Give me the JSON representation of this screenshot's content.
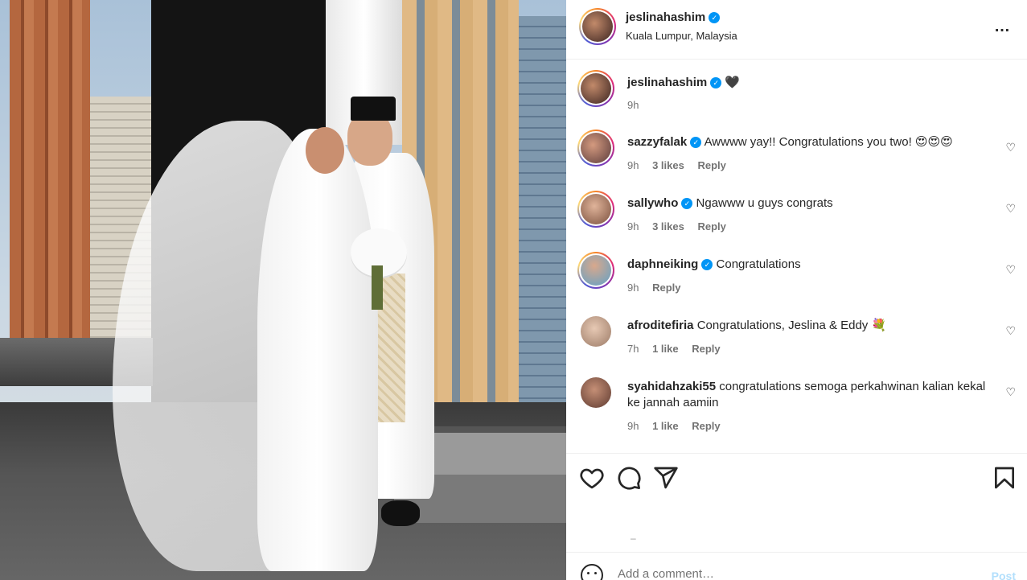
{
  "post": {
    "username": "jeslinahashim",
    "location": "Kuala Lumpur, Malaysia",
    "more_icon": "…",
    "caption_text": "🖤",
    "caption_time": "9h",
    "photo_alt": "Wedding couple in white standing by a window"
  },
  "comments": [
    {
      "user": "sazzyfalak",
      "verified": true,
      "text": "Awwww yay!! Congratulations you two! 😍😍😍",
      "time": "9h",
      "likes": "3 likes",
      "reply": "Reply",
      "avatar_color": "#5a3b3b",
      "ring": true
    },
    {
      "user": "sallywho",
      "verified": true,
      "text": "Ngawww u guys congrats",
      "time": "9h",
      "likes": "3 likes",
      "reply": "Reply",
      "avatar_color": "#b5856a",
      "ring": true
    },
    {
      "user": "daphneiking",
      "verified": true,
      "text": "Congratulations",
      "time": "9h",
      "likes": "",
      "reply": "Reply",
      "avatar_color": "#5fa1c8",
      "ring": true
    },
    {
      "user": "afroditefiria",
      "verified": false,
      "text": "Congratulations, Jeslina & Eddy 💐",
      "time": "7h",
      "likes": "1 like",
      "reply": "Reply",
      "avatar_color": "#c9a894",
      "ring": false
    },
    {
      "user": "syahidahzaki55",
      "verified": false,
      "text": "congratulations semoga perkahwinan kalian kekal ke jannah aamiin",
      "time": "9h",
      "likes": "1 like",
      "reply": "Reply",
      "avatar_color": "#8a5a4a",
      "ring": false
    }
  ],
  "actions": {
    "like_icon": "heart-icon",
    "comment_icon": "comment-icon",
    "share_icon": "share-icon",
    "save_icon": "bookmark-icon"
  },
  "add_comment": {
    "placeholder": "Add a comment…",
    "post_label": "Post"
  },
  "colors": {
    "verified": "#0095f6",
    "post_disabled": "#b2dffc",
    "muted": "#737373"
  }
}
